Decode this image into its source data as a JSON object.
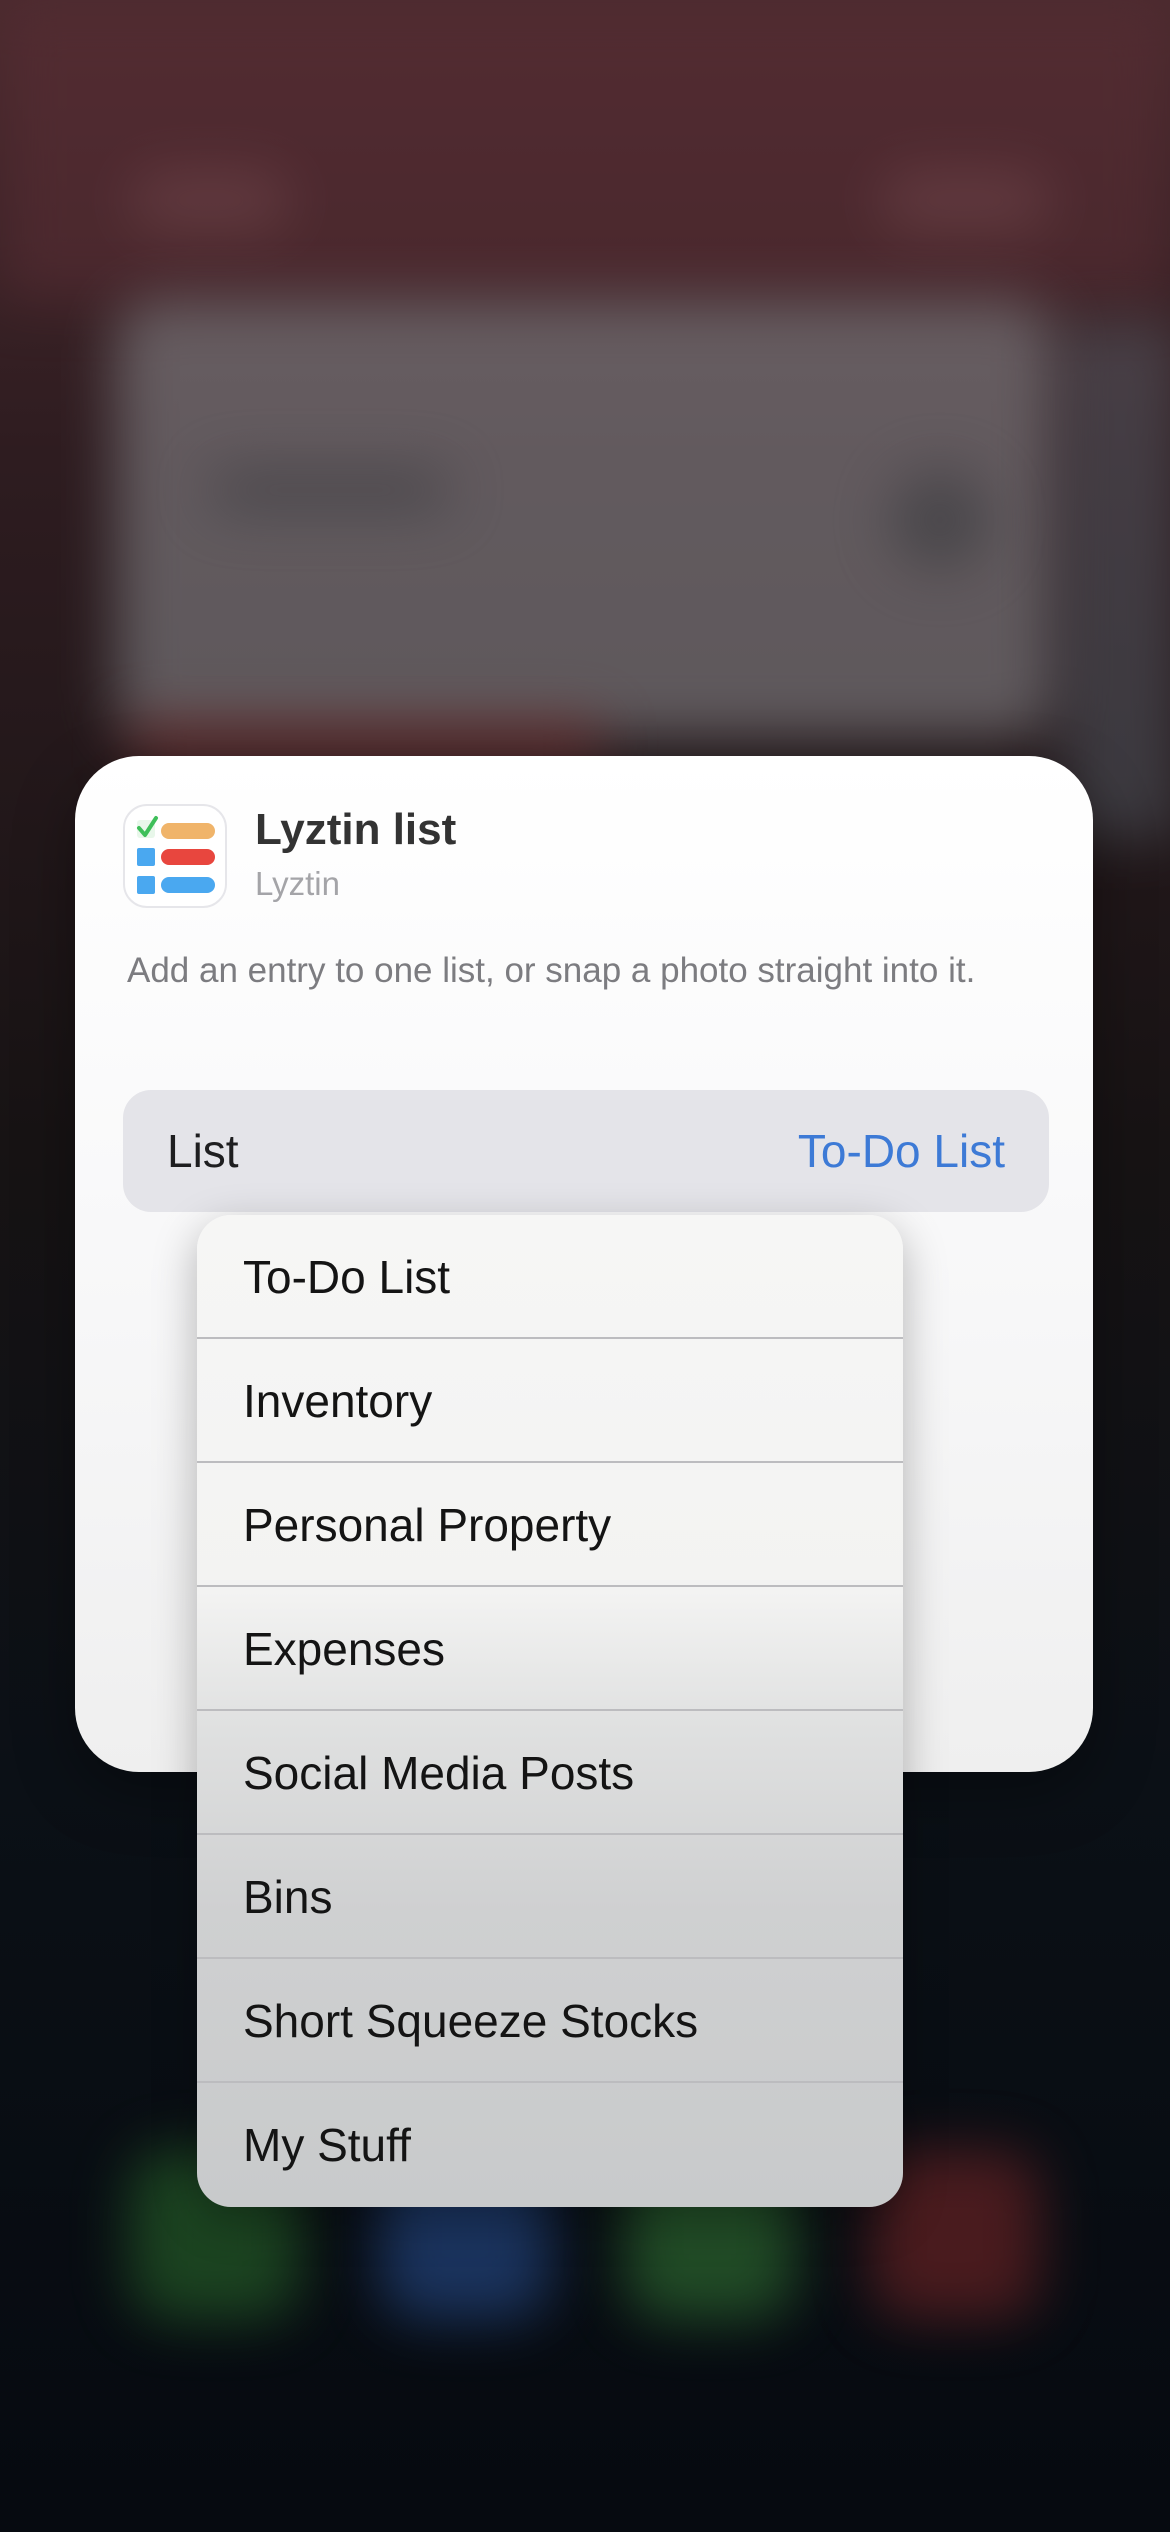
{
  "app": {
    "title": "Lyztin list",
    "subtitle": "Lyztin",
    "icon": "lyztin-app-icon"
  },
  "description": "Add an entry to one list, or snap a photo straight into it.",
  "list_field": {
    "label": "List",
    "value": "To-Do List"
  },
  "dropdown": {
    "items": [
      {
        "label": "To-Do List"
      },
      {
        "label": "Inventory"
      },
      {
        "label": "Personal Property"
      },
      {
        "label": "Expenses"
      },
      {
        "label": "Social Media Posts"
      },
      {
        "label": "Bins"
      },
      {
        "label": "Short Squeeze Stocks"
      },
      {
        "label": "My Stuff"
      }
    ]
  },
  "colors": {
    "accent": "#3d7ad6",
    "icon_orange": "#f0b46a",
    "icon_red": "#e8463e",
    "icon_blue": "#4aa8f0",
    "icon_check": "#3fbf5a"
  }
}
